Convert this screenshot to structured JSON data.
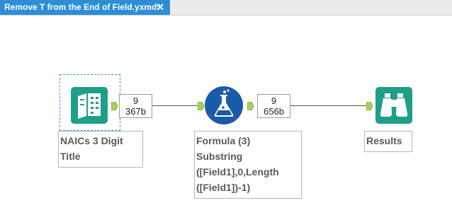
{
  "tab": {
    "title": "Remove T from the End of Field.yxmd*",
    "close": "✕"
  },
  "colors": {
    "tab": "#2c8fd6",
    "input_tool": "#1f9e8a",
    "formula_tool": "#1a5aa8",
    "browse_tool": "#1f9e8a",
    "anchor": "#a6d15a"
  },
  "tools": {
    "input": {
      "icon": "book-icon",
      "label_line1": "NAICs 3 Digit",
      "label_line2": "Title"
    },
    "formula": {
      "icon": "flask-icon",
      "label_line1": "Formula (3)",
      "label_line2": "Substring",
      "label_line3": "([Field1],0,Length",
      "label_line4": "([Field1])-1)"
    },
    "browse": {
      "icon": "binoculars-icon",
      "label": "Results"
    }
  },
  "connections": [
    {
      "records": "9",
      "size": "367b"
    },
    {
      "records": "9",
      "size": "656b"
    }
  ]
}
